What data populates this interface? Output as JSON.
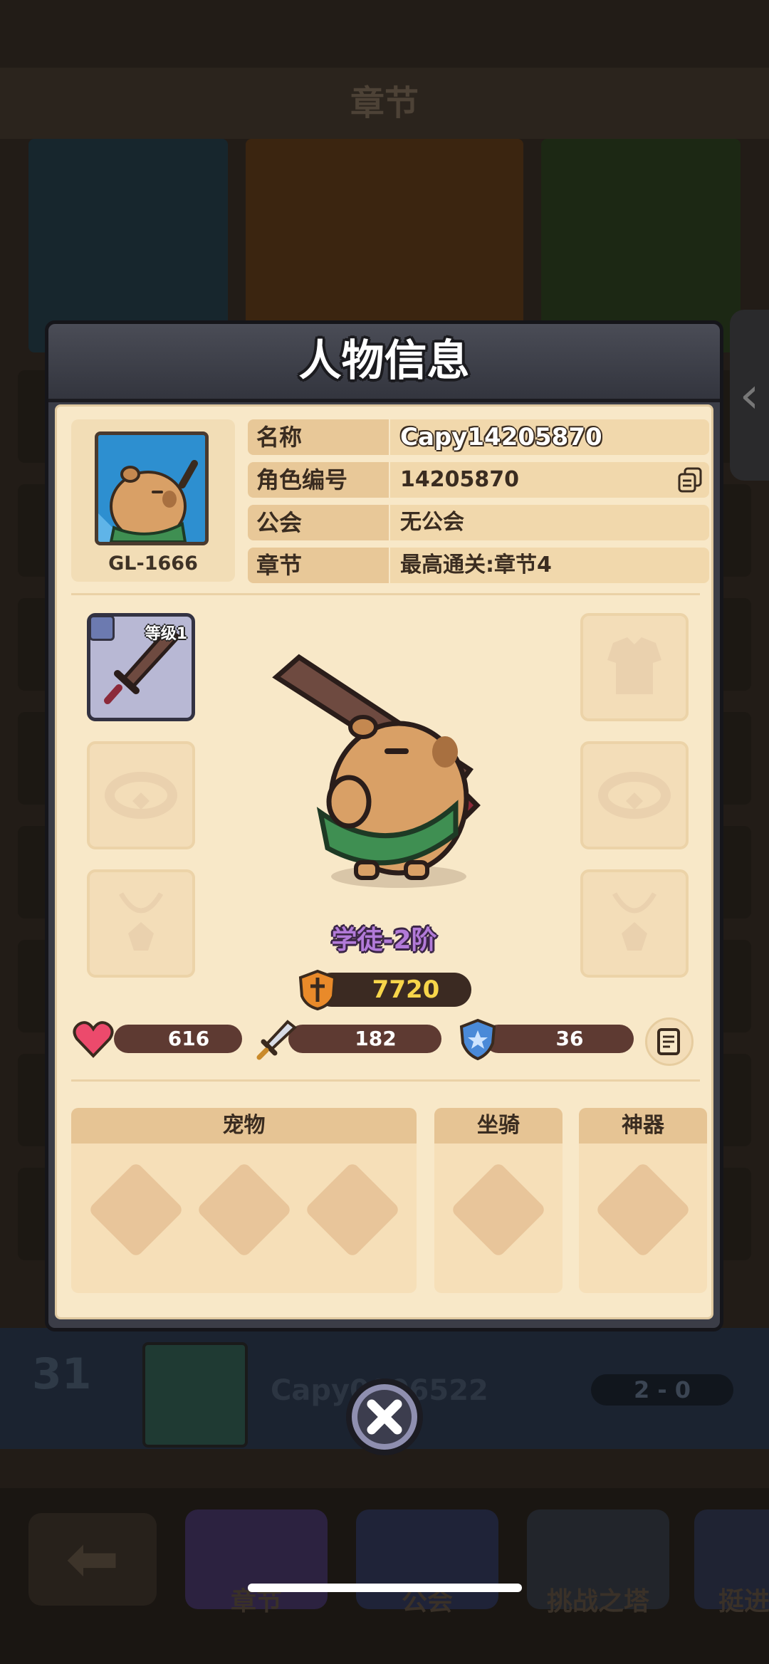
{
  "background": {
    "header_title": "章节",
    "rank_number": "31",
    "rank_name": "Capy0006522",
    "rank_score": "2 - 0",
    "nav_tabs": [
      "章节",
      "公会",
      "挑战之塔",
      "挺进"
    ]
  },
  "modal": {
    "title": "人物信息",
    "avatar_id": "GL-1666",
    "info": {
      "name_label": "名称",
      "name_value": "Capy14205870",
      "role_id_label": "角色编号",
      "role_id_value": "14205870",
      "guild_label": "公会",
      "guild_value": "无公会",
      "chapter_label": "章节",
      "chapter_value": "最高通关:章节4"
    },
    "equipment": {
      "weapon_level": "等级1",
      "slots": [
        "weapon",
        "armor",
        "ring",
        "ring",
        "necklace",
        "necklace"
      ]
    },
    "rank": "学徒-2阶",
    "power": "7720",
    "stats": {
      "hp": "616",
      "attack": "182",
      "defense": "36"
    },
    "sections": {
      "pet_label": "宠物",
      "mount_label": "坐骑",
      "artifact_label": "神器"
    }
  },
  "colors": {
    "panel": "#f8e8c8",
    "header": "#3b3d47",
    "accent_power": "#f7d54a",
    "rank_purple": "#b27ad8"
  }
}
